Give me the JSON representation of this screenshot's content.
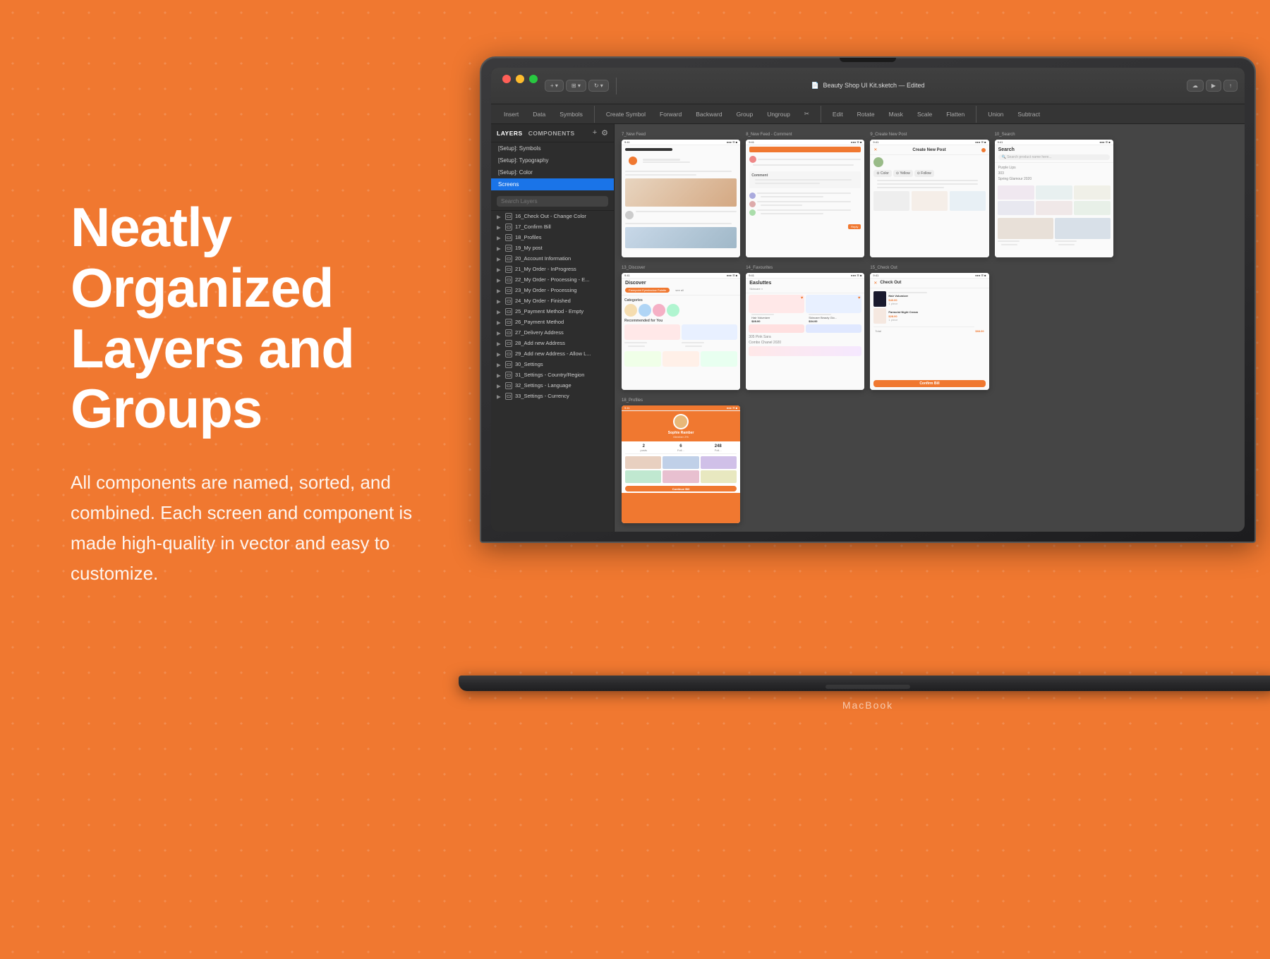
{
  "page": {
    "background_color": "#F07830",
    "title": "Neatly Organized Layers and Groups",
    "heading_line1": "Neatly",
    "heading_line2": "Organized",
    "heading_line3": "Layers and",
    "heading_line4": "Groups",
    "description": "All components are named, sorted, and combined. Each screen and component is made high-quality in vector and easy to customize.",
    "macbook_label": "MacBook"
  },
  "sketch": {
    "window_title": "Beauty Shop UI Kit.sketch — Edited",
    "toolbar": {
      "buttons": [
        "Insert",
        "Data",
        "Symbols",
        "Create Symbol",
        "Forward",
        "Backward",
        "Group",
        "Ungroup",
        "Scissors",
        "Edit",
        "Rotate",
        "Mask",
        "Scale",
        "Flatten",
        "Union",
        "Subtract"
      ]
    },
    "sidebar_tabs": [
      "LAYERS",
      "COMPONENTS"
    ],
    "setup_items": [
      "[Setup]: Symbols",
      "[Setup]: Typography",
      "[Setup]: Color"
    ],
    "selected_item": "Screens",
    "search_placeholder": "Search Layers",
    "layer_items": [
      "16_Check Out - Change Color",
      "17_Confirm Bill",
      "18_Profiles",
      "19_My post",
      "20_Account Information",
      "21_My Order - InProgress",
      "22_My Order - Processing - E...",
      "23_My Order - Processing",
      "24_My Order - Finished",
      "25_Payment Method - Empty",
      "26_Payment Method",
      "27_Delivery Address",
      "28_Add new Address",
      "29_Add new Address - Allow L...",
      "30_Settings",
      "31_Settings - Country/Region",
      "32_Settings - Language",
      "33_Settings - Currency"
    ],
    "artboard_labels": [
      "7_New Feed",
      "8_New Feed - Comment",
      "9_Create New Post",
      "10_Search",
      "13_Discover",
      "14_Favourites",
      "15_Check Out",
      "18_Profiles"
    ]
  }
}
